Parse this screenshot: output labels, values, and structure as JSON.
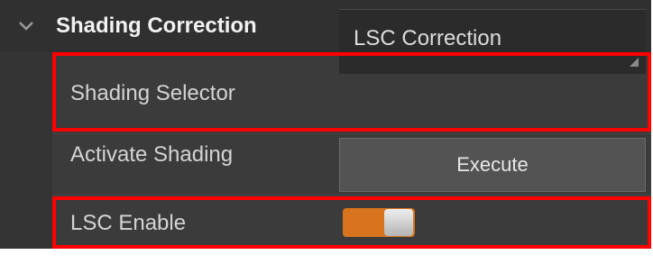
{
  "section": {
    "title": "Shading Correction",
    "collapse_icon": "chevron-down-icon"
  },
  "rows": [
    {
      "label": "Shading Selector",
      "control": "select",
      "value": "LSC Correction"
    },
    {
      "label": "Activate Shading",
      "control": "button",
      "button_label": "Execute"
    },
    {
      "label": "LSC Enable",
      "control": "toggle",
      "enabled": true
    }
  ],
  "colors": {
    "panel_bg": "#3b3b3b",
    "toggle_on": "#d8741e",
    "highlight": "#ff0000"
  }
}
